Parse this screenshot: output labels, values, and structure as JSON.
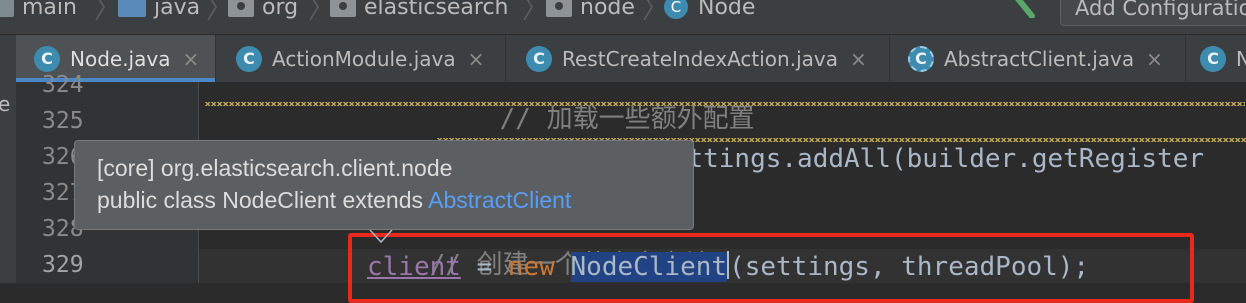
{
  "breadcrumb": {
    "items": [
      {
        "label": "main",
        "icon": "folder-icon"
      },
      {
        "label": "java",
        "icon": "source-folder-icon"
      },
      {
        "label": "org",
        "icon": "package-icon"
      },
      {
        "label": "elasticsearch",
        "icon": "package-icon"
      },
      {
        "label": "node",
        "icon": "package-icon"
      },
      {
        "label": "Node",
        "icon": "class-icon"
      }
    ],
    "class_icon_letter": "C"
  },
  "toolbar": {
    "run_config_label": "Add Configuration..."
  },
  "tabs": [
    {
      "label": "Node.java",
      "icon_letter": "C",
      "active": true
    },
    {
      "label": "ActionModule.java",
      "icon_letter": "C",
      "active": false
    },
    {
      "label": "RestCreateIndexAction.java",
      "icon_letter": "C",
      "active": false
    },
    {
      "label": "AbstractClient.java",
      "icon_letter": "C",
      "active": false
    },
    {
      "label": "N",
      "icon_letter": "C",
      "active": false
    }
  ],
  "tab_close_glyph": "×",
  "left_strip_text": "e",
  "editor": {
    "line_numbers": [
      "324",
      "325",
      "326",
      "327",
      "328",
      "329"
    ],
    "current_line": "329",
    "lines": {
      "l324_comment": "// 加载一些额外配置",
      "l325_code": "additionalSettings.addAll(builder.getRegister",
      "l328_comment": "// 创建一个节点客户端",
      "l329_field": "client",
      "l329_eq": " = ",
      "l329_new": "new ",
      "l329_class": "NodeClient",
      "l329_args": "(settings, threadPool);"
    }
  },
  "quick_doc": {
    "module_line": "[core] org.elasticsearch.client.node",
    "signature_prefix": "public class NodeClient extends ",
    "signature_link": "AbstractClient"
  },
  "colors": {
    "highlight_box": "#e8291c",
    "selection": "#214283",
    "keyword": "#cc7832",
    "field": "#9876aa",
    "link": "#589df6"
  }
}
